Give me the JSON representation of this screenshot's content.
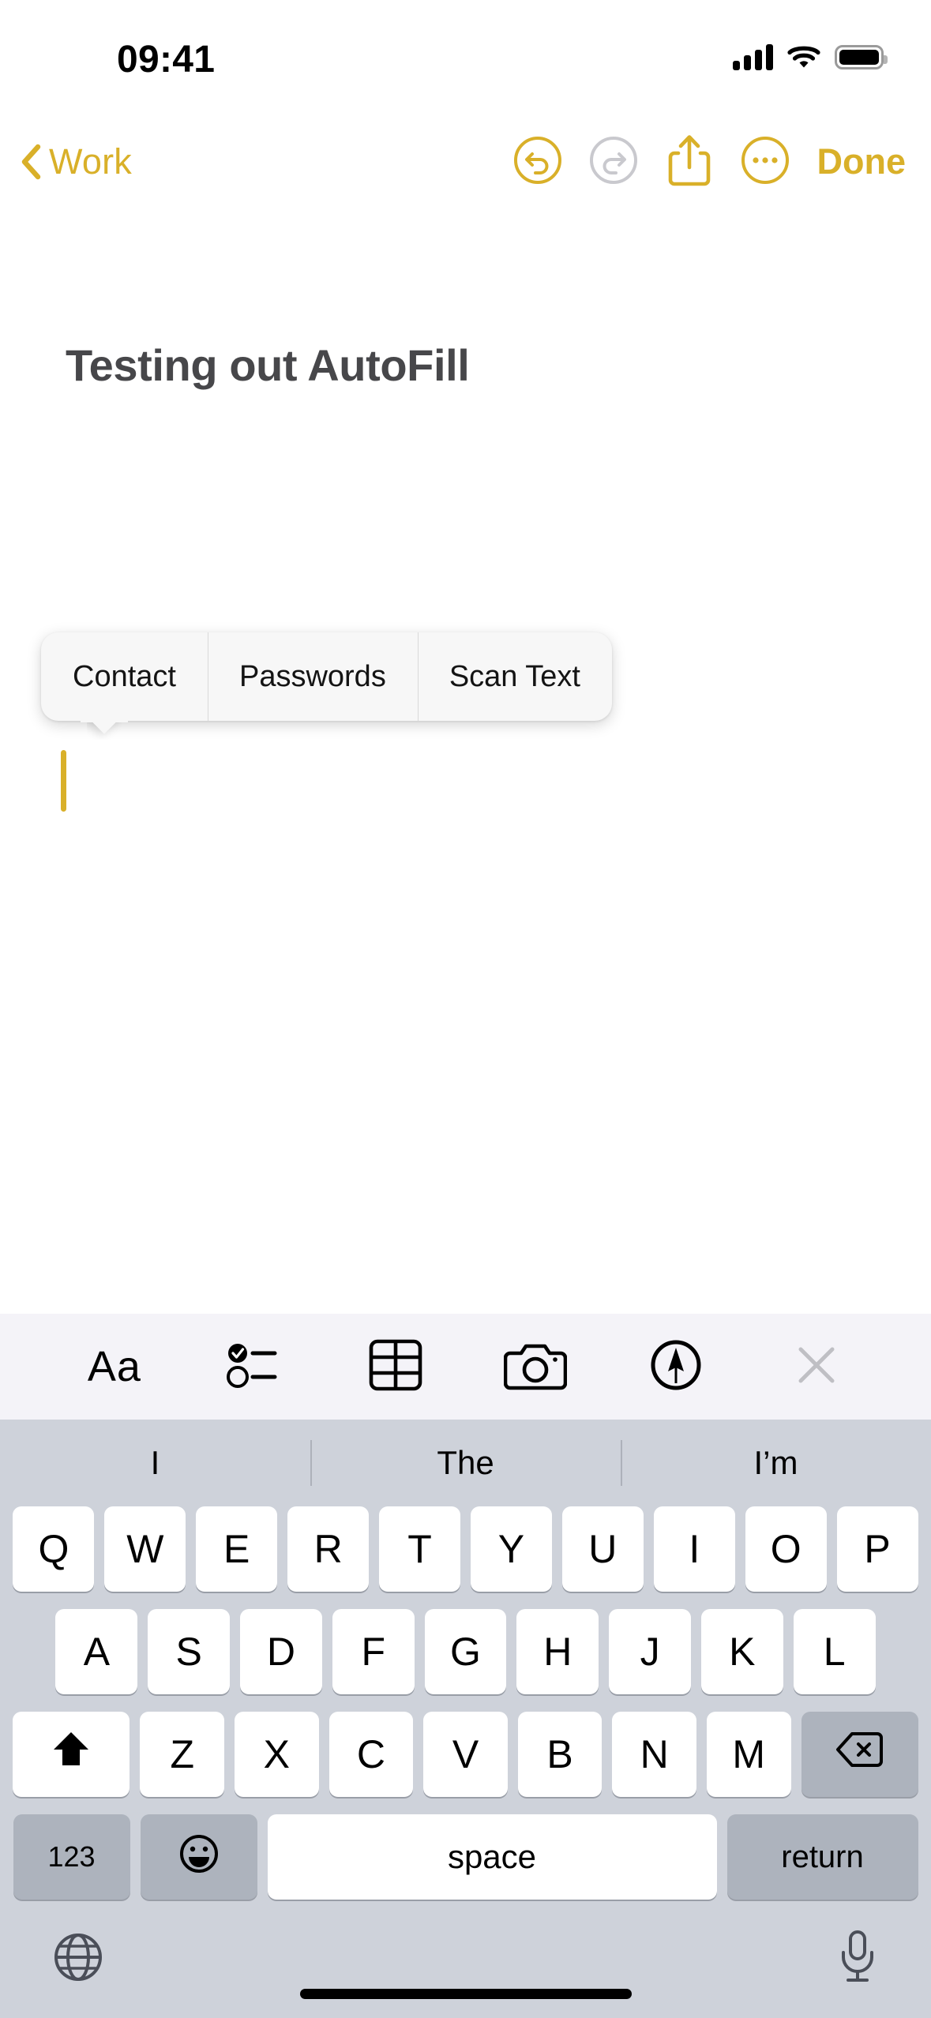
{
  "status_bar": {
    "time": "09:41",
    "icons": [
      "signal-bars-icon",
      "wifi-icon",
      "battery-icon"
    ],
    "signal_bars": 4,
    "battery_full": true
  },
  "nav_bar": {
    "back_label": "Work",
    "back_icon": "chevron-left-icon",
    "undo_icon": "undo-circle-icon",
    "undo_enabled": true,
    "redo_icon": "redo-circle-icon",
    "redo_enabled": false,
    "share_icon": "share-icon",
    "more_icon": "ellipsis-circle-icon",
    "done_label": "Done",
    "accent_color": "#D9B029",
    "disabled_color": "#C7C7CC"
  },
  "note": {
    "title": "Testing out AutoFill",
    "title_color": "#47474A",
    "cursor_color": "#D9B029"
  },
  "autofill_popover": {
    "items": [
      {
        "label": "Contact"
      },
      {
        "label": "Passwords"
      },
      {
        "label": "Scan Text"
      }
    ],
    "background": "#F7F7F7"
  },
  "format_toolbar": {
    "background": "#F4F3F8",
    "buttons": [
      {
        "name": "format-aa-button",
        "label": "Aa",
        "icon": "text-format-icon"
      },
      {
        "name": "checklist-button",
        "label": "",
        "icon": "checklist-icon"
      },
      {
        "name": "table-button",
        "label": "",
        "icon": "table-icon"
      },
      {
        "name": "camera-button",
        "label": "",
        "icon": "camera-icon"
      },
      {
        "name": "markup-button",
        "label": "",
        "icon": "markup-pen-icon"
      },
      {
        "name": "close-keyboard-button",
        "label": "",
        "icon": "close-x-icon"
      }
    ]
  },
  "keyboard": {
    "background": "#CED2DA",
    "predictions": [
      "I",
      "The",
      "I’m"
    ],
    "rows": {
      "row1": [
        "Q",
        "W",
        "E",
        "R",
        "T",
        "Y",
        "U",
        "I",
        "O",
        "P"
      ],
      "row2": [
        "A",
        "S",
        "D",
        "F",
        "G",
        "H",
        "J",
        "K",
        "L"
      ],
      "row3": [
        "Z",
        "X",
        "C",
        "V",
        "B",
        "N",
        "M"
      ]
    },
    "shift_icon": "shift-arrow-icon",
    "backspace_icon": "backspace-delete-icon",
    "numbers_label": "123",
    "emoji_icon": "emoji-smiley-icon",
    "space_label": "space",
    "return_label": "return",
    "globe_icon": "globe-icon",
    "dictation_icon": "microphone-icon"
  }
}
